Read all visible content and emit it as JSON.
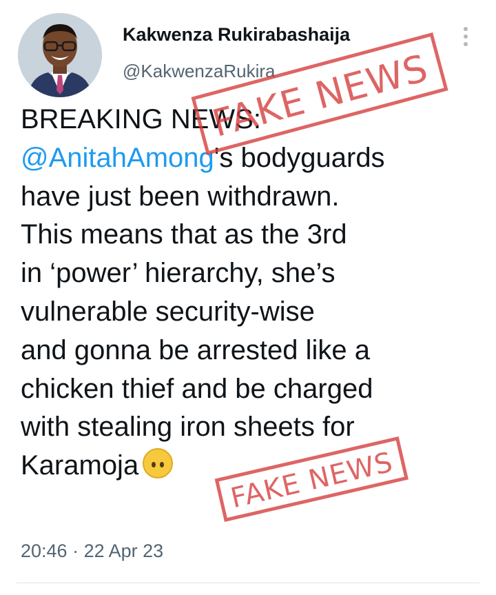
{
  "tweet": {
    "author_name": "Kakwenza Rukirabashaija",
    "handle": "@KakwenzaRukira",
    "more_icon": "more-vertical-icon",
    "body_lines": [
      "BREAKING NEWS:",
      "'s bodyguards",
      "have just been withdrawn.",
      "This means that as the 3rd",
      "in ‘power’ hierarchy, she’s",
      "vulnerable security-wise",
      "and gonna be arrested like a",
      "chicken thief and be charged",
      "with stealing iron sheets for",
      "Karamoja"
    ],
    "mention": "@AnitahAmong",
    "emoji": "upside-down-face-emoji",
    "time": "20:46",
    "separator": "·",
    "date": "22 Apr 23"
  },
  "stamps": {
    "top_text": "FAKE NEWS",
    "bottom_text": "FAKE NEWS",
    "color": "#d63b3b"
  },
  "colors": {
    "link": "#1d9bf0",
    "secondary_text": "#536471"
  }
}
